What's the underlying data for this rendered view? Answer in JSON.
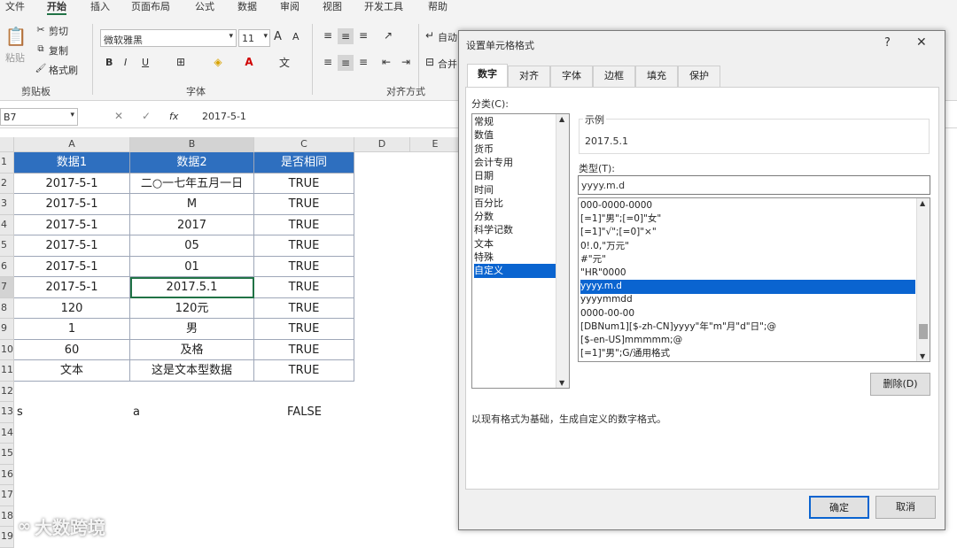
{
  "menu": [
    "文件",
    "开始",
    "插入",
    "页面布局",
    "公式",
    "数据",
    "审阅",
    "视图",
    "开发工具",
    "帮助"
  ],
  "ribbon": {
    "paste_label": "粘贴",
    "cut_label": "剪切",
    "copy_label": "复制",
    "format_painter_label": "格式刷",
    "clipboard_group": "剪贴板",
    "font_name": "微软雅黑",
    "font_size": "11",
    "font_group": "字体",
    "align_group": "对齐方式",
    "wrap_label": "自动",
    "merge_label": "合并",
    "bold": "B",
    "italic": "I",
    "underline": "U",
    "grow_font": "A",
    "shrink_font": "A"
  },
  "formula_bar": {
    "name_box": "B7",
    "fx": "fx",
    "value": "2017-5-1"
  },
  "sheet": {
    "columns": [
      "A",
      "B",
      "C",
      "D",
      "E"
    ],
    "rows": [
      "1",
      "2",
      "3",
      "4",
      "5",
      "6",
      "7",
      "8",
      "9",
      "10",
      "11",
      "12",
      "13",
      "14",
      "15",
      "16",
      "17",
      "18",
      "19"
    ],
    "header": [
      "数据1",
      "数据2",
      "是否相同"
    ],
    "data": [
      [
        "2017-5-1",
        "二○一七年五月一日",
        "TRUE"
      ],
      [
        "2017-5-1",
        "M",
        "TRUE"
      ],
      [
        "2017-5-1",
        "2017",
        "TRUE"
      ],
      [
        "2017-5-1",
        "05",
        "TRUE"
      ],
      [
        "2017-5-1",
        "01",
        "TRUE"
      ],
      [
        "2017-5-1",
        "2017.5.1",
        "TRUE"
      ],
      [
        "120",
        "120元",
        "TRUE"
      ],
      [
        "1",
        "男",
        "TRUE"
      ],
      [
        "60",
        "及格",
        "TRUE"
      ],
      [
        "文本",
        "这是文本型数据",
        "TRUE"
      ]
    ],
    "row13": [
      "s",
      "a",
      "FALSE"
    ]
  },
  "dialog": {
    "title": "设置单元格格式",
    "help": "?",
    "close": "✕",
    "tabs": [
      "数字",
      "对齐",
      "字体",
      "边框",
      "填充",
      "保护"
    ],
    "category_label": "分类(C):",
    "categories": [
      "常规",
      "数值",
      "货币",
      "会计专用",
      "日期",
      "时间",
      "百分比",
      "分数",
      "科学记数",
      "文本",
      "特殊",
      "自定义"
    ],
    "selected_category": 11,
    "sample_label": "示例",
    "sample_value": "2017.5.1",
    "type_label": "类型(T):",
    "type_value": "yyyy.m.d",
    "formats": [
      "000-0000-0000",
      "[=1]\"男\";[=0]\"女\"",
      "[=1]\"√\";[=0]\"×\"",
      "0!.0,\"万元\"",
      "#\"元\"",
      "\"HR\"0000",
      "yyyy.m.d",
      "yyyymmdd",
      "0000-00-00",
      "[DBNum1][$-zh-CN]yyyy\"年\"m\"月\"d\"日\";@",
      "[$-en-US]mmmmm;@",
      "[=1]\"男\";G/通用格式"
    ],
    "selected_format": 6,
    "delete_button": "删除(D)",
    "description": "以现有格式为基础，生成自定义的数字格式。",
    "ok_button": "确定",
    "cancel_button": "取消"
  },
  "watermark": "大数跨境",
  "colors": {
    "header_fill": "#2e6fbf",
    "selection": "#0a64d0",
    "excel_green": "#217346"
  }
}
